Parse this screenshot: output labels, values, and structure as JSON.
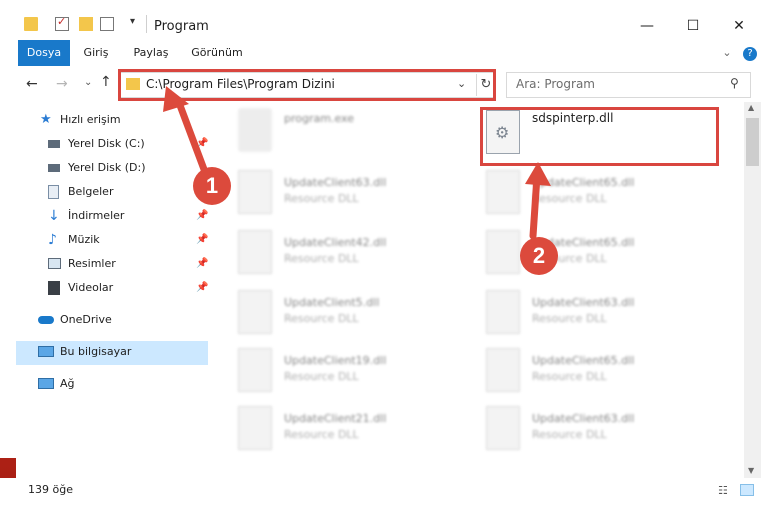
{
  "window": {
    "title": "Program",
    "controls": {
      "minimize": "—",
      "maximize": "☐",
      "close": "✕"
    }
  },
  "ribbon": {
    "tabs": [
      "Dosya",
      "Giriş",
      "Paylaş",
      "Görünüm"
    ],
    "expand_icon": "chevron-down-icon",
    "help_icon": "?"
  },
  "nav": {
    "address": "C:\\Program Files\\Program Dizini",
    "search_placeholder": "Ara: Program"
  },
  "sidebar": {
    "items": [
      {
        "label": "Hızlı erişim",
        "icon": "star-icon"
      },
      {
        "label": "Yerel Disk (C:)",
        "icon": "drive-icon"
      },
      {
        "label": "Yerel Disk (D:)",
        "icon": "drive-icon"
      },
      {
        "label": "Belgeler",
        "icon": "documents-icon"
      },
      {
        "label": "İndirmeler",
        "icon": "download-icon"
      },
      {
        "label": "Müzik",
        "icon": "music-icon"
      },
      {
        "label": "Resimler",
        "icon": "pictures-icon"
      },
      {
        "label": "Videolar",
        "icon": "videos-icon"
      },
      {
        "label": "OneDrive",
        "icon": "cloud-icon"
      },
      {
        "label": "Bu bilgisayar",
        "icon": "computer-icon"
      },
      {
        "label": "Ağ",
        "icon": "network-icon"
      }
    ]
  },
  "files": {
    "left": [
      {
        "name": "program.exe",
        "type": ""
      },
      {
        "name": "UpdateClient63.dll",
        "type": "Resource DLL"
      },
      {
        "name": "UpdateClient42.dll",
        "type": "Resource DLL"
      },
      {
        "name": "UpdateClient5.dll",
        "type": "Resource DLL"
      },
      {
        "name": "UpdateClient19.dll",
        "type": "Resource DLL"
      },
      {
        "name": "UpdateClient21.dll",
        "type": "Resource DLL"
      }
    ],
    "right": [
      {
        "name": "sdspinterp.dll",
        "type": ""
      },
      {
        "name": "UpdateClient65.dll",
        "type": "Resource DLL"
      },
      {
        "name": "UpdateClient65.dll",
        "type": "Resource DLL"
      },
      {
        "name": "UpdateClient63.dll",
        "type": "Resource DLL"
      },
      {
        "name": "UpdateClient65.dll",
        "type": "Resource DLL"
      },
      {
        "name": "UpdateClient63.dll",
        "type": "Resource DLL"
      }
    ]
  },
  "status": {
    "count": "139 öğe"
  },
  "annotations": {
    "step1": "1",
    "step2": "2"
  },
  "colors": {
    "accent": "#1979ca",
    "annotation": "#d9463f",
    "selection": "#cce8ff"
  }
}
